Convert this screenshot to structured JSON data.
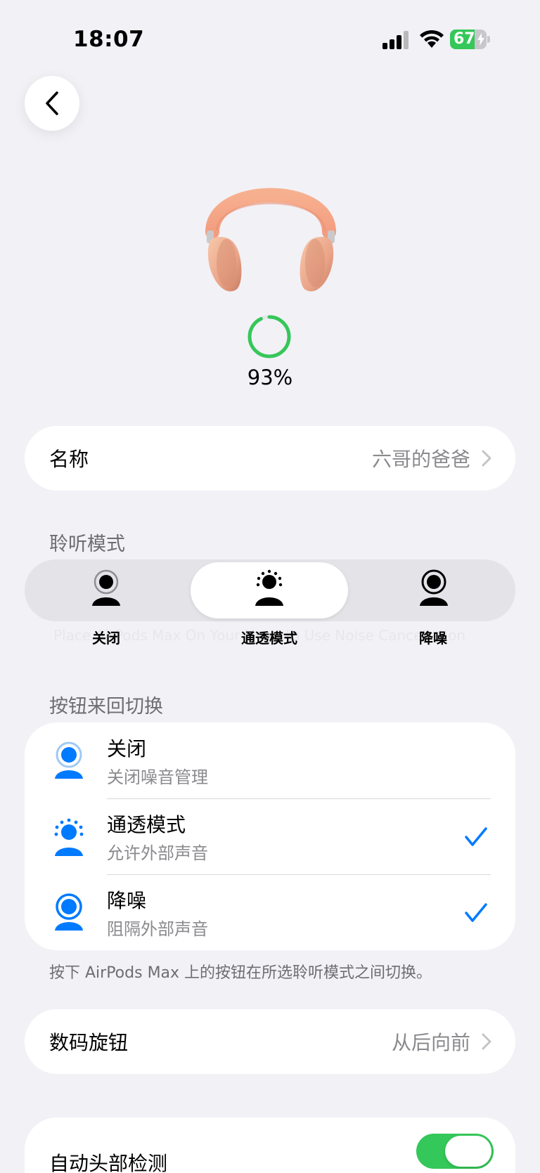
{
  "status_bar": {
    "time": "18:07",
    "battery_level": "67",
    "battery_color": "#34c759",
    "icons": [
      "signal-icon",
      "wifi-icon",
      "battery-charging-icon"
    ]
  },
  "nav": {
    "back_icon": "chevron-left-icon"
  },
  "device": {
    "image": "airpods-max-pink",
    "battery_percent_label": "93%",
    "battery_fraction": 0.93,
    "ring_color": "#34c759"
  },
  "name_row": {
    "label": "名称",
    "value": "六哥的爸爸"
  },
  "listening_mode": {
    "title": "聆听模式",
    "options": [
      {
        "label": "关闭",
        "icon": "person-off-icon",
        "selected": false
      },
      {
        "label": "通透模式",
        "icon": "person-transparency-icon",
        "selected": true
      },
      {
        "label": "降噪",
        "icon": "person-noise-cancel-icon",
        "selected": false
      }
    ],
    "ghost_text": "Place AirPods Max On Your Head to Use Noise Cancellation"
  },
  "press_cycle": {
    "title": "按钮来回切换",
    "items": [
      {
        "title": "关闭",
        "subtitle": "关闭噪音管理",
        "checked": false
      },
      {
        "title": "通透模式",
        "subtitle": "允许外部声音",
        "checked": true
      },
      {
        "title": "降噪",
        "subtitle": "阻隔外部声音",
        "checked": true
      }
    ],
    "footnote": "按下 AirPods Max 上的按钮在所选聆听模式之间切换。",
    "accent": "#007aff"
  },
  "digital_crown": {
    "label": "数码旋钮",
    "value": "从后向前"
  },
  "auto_head": {
    "label": "自动头部检测",
    "enabled": true
  }
}
